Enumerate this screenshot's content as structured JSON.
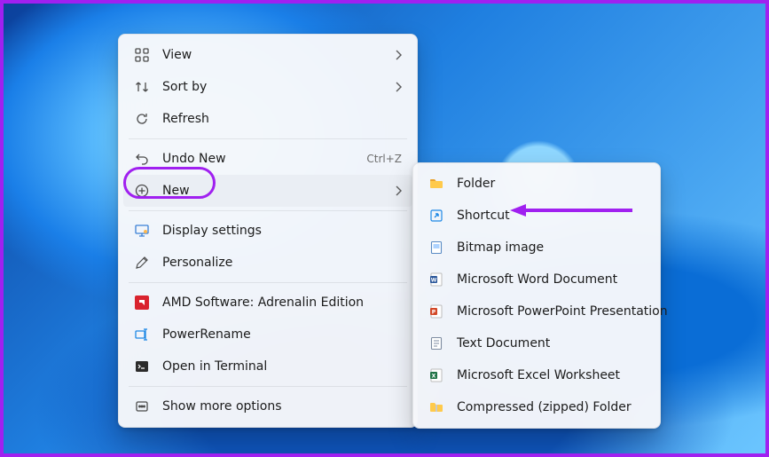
{
  "context_menu": {
    "view": "View",
    "sort_by": "Sort by",
    "refresh": "Refresh",
    "undo_new": "Undo New",
    "undo_new_accel": "Ctrl+Z",
    "new": "New",
    "display_settings": "Display settings",
    "personalize": "Personalize",
    "amd": "AMD Software: Adrenalin Edition",
    "power_rename": "PowerRename",
    "open_terminal": "Open in Terminal",
    "show_more": "Show more options"
  },
  "new_submenu": {
    "folder": "Folder",
    "shortcut": "Shortcut",
    "bitmap": "Bitmap image",
    "word": "Microsoft Word Document",
    "powerpoint": "Microsoft PowerPoint Presentation",
    "text": "Text Document",
    "excel": "Microsoft Excel Worksheet",
    "zip": "Compressed (zipped) Folder"
  },
  "highlight": {
    "circled_item": "New",
    "arrow_target": "Shortcut",
    "color": "#a020f0"
  }
}
